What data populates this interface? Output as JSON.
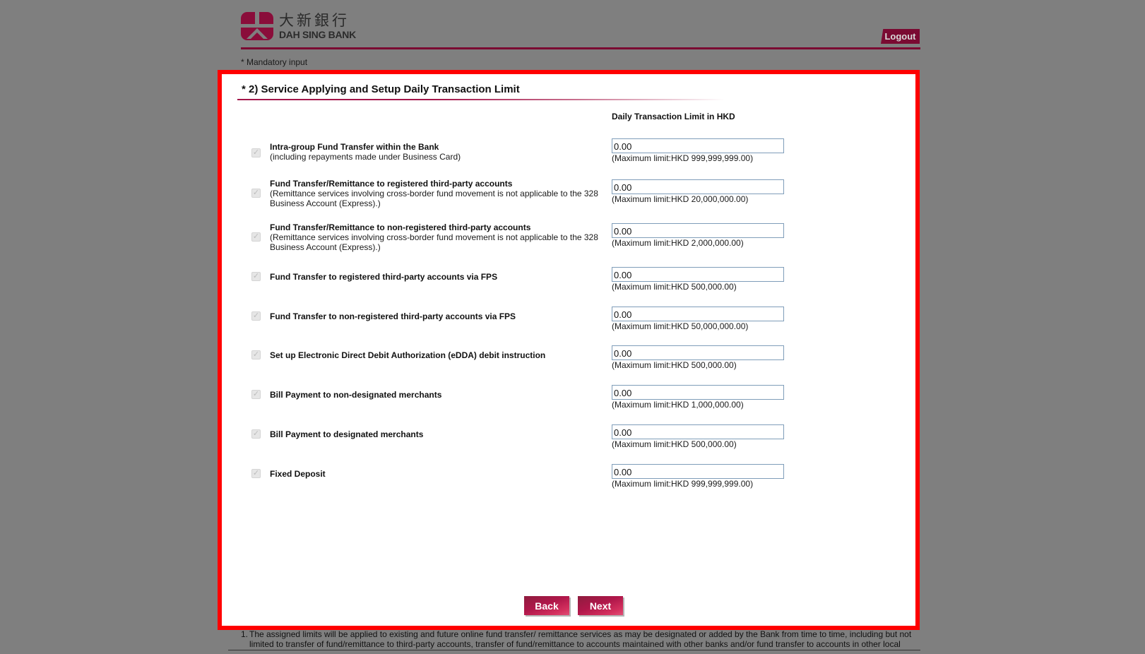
{
  "header": {
    "logo_cn": "大新銀行",
    "logo_en": "DAH SING BANK",
    "logout_label": "Logout",
    "mandatory_note": "* Mandatory input",
    "brand_color": "#7a0a32"
  },
  "section": {
    "title": "* 2) Service Applying and Setup Daily Transaction Limit",
    "column_header": "Daily Transaction Limit in HKD"
  },
  "services": [
    {
      "title": "Intra-group Fund Transfer within the Bank",
      "subtitle": "(including repayments made under Business Card)",
      "checked": true,
      "amount": "0.00",
      "max_limit": "(Maximum limit:HKD 999,999,999.00)"
    },
    {
      "title": "Fund Transfer/Remittance to registered third-party accounts",
      "subtitle": "(Remittance services involving cross-border fund movement is not applicable to the 328 Business Account (Express).)",
      "checked": true,
      "amount": "0.00",
      "max_limit": "(Maximum limit:HKD 20,000,000.00)"
    },
    {
      "title": "Fund Transfer/Remittance to non-registered third-party accounts",
      "subtitle": "(Remittance services involving cross-border fund movement is not applicable to the 328 Business Account (Express).)",
      "checked": true,
      "amount": "0.00",
      "max_limit": "(Maximum limit:HKD 2,000,000.00)"
    },
    {
      "title": "Fund Transfer to registered third-party accounts via FPS",
      "subtitle": "",
      "checked": true,
      "amount": "0.00",
      "max_limit": "(Maximum limit:HKD 500,000.00)"
    },
    {
      "title": "Fund Transfer to non-registered third-party accounts via FPS",
      "subtitle": "",
      "checked": true,
      "amount": "0.00",
      "max_limit": "(Maximum limit:HKD 50,000,000.00)"
    },
    {
      "title": "Set up Electronic Direct Debit Authorization (eDDA) debit instruction",
      "subtitle": "",
      "checked": true,
      "amount": "0.00",
      "max_limit": "(Maximum limit:HKD 500,000.00)"
    },
    {
      "title": "Bill Payment to non-designated merchants",
      "subtitle": "",
      "checked": true,
      "amount": "0.00",
      "max_limit": "(Maximum limit:HKD 1,000,000.00)"
    },
    {
      "title": "Bill Payment to designated merchants",
      "subtitle": "",
      "checked": true,
      "amount": "0.00",
      "max_limit": "(Maximum limit:HKD 500,000.00)"
    },
    {
      "title": "Fixed Deposit",
      "subtitle": "",
      "checked": true,
      "amount": "0.00",
      "max_limit": "(Maximum limit:HKD 999,999,999.00)"
    }
  ],
  "buttons": {
    "back_label": "Back",
    "next_label": "Next"
  },
  "footnote": {
    "number": "1.",
    "text": "The assigned limits will be applied to existing and future online fund transfer/ remittance services as may be designated or added by the Bank from time to time, including but not limited to transfer of fund/remittance to third-party accounts, transfer of fund/remittance to accounts maintained with other banks and/or fund transfer to accounts in other local"
  },
  "highlight_color": "#ff0000"
}
